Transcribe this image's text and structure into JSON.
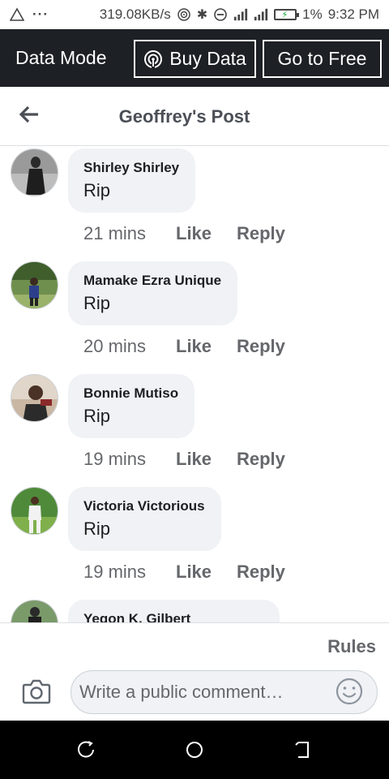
{
  "status_bar": {
    "speed": "319.08KB/s",
    "battery_percent": "1%",
    "time": "9:32 PM"
  },
  "data_bar": {
    "mode_label": "Data Mode",
    "buy_data_label": "Buy Data",
    "go_free_label": "Go to Free"
  },
  "header": {
    "title": "Geoffrey's Post"
  },
  "comments": [
    {
      "author": "Shirley Shirley",
      "text": "Rip",
      "time": "21 mins",
      "like": "Like",
      "reply": "Reply"
    },
    {
      "author": "Mamake Ezra Unique",
      "text": "Rip",
      "time": "20 mins",
      "like": "Like",
      "reply": "Reply"
    },
    {
      "author": "Bonnie Mutiso",
      "text": "Rip",
      "time": "19 mins",
      "like": "Like",
      "reply": "Reply"
    },
    {
      "author": "Victoria Victorious",
      "text": "Rip",
      "time": "19 mins",
      "like": "Like",
      "reply": "Reply"
    },
    {
      "author": "Yegon K. Gilbert",
      "text": "",
      "time": "",
      "like": "",
      "reply": ""
    }
  ],
  "composer": {
    "rules_label": "Rules",
    "placeholder": "Write a public comment…"
  },
  "icons": {
    "back": "back-arrow-icon",
    "camera": "camera-icon",
    "emoji": "smile-icon",
    "buy_data": "hotspot-icon"
  },
  "colors": {
    "data_bar_bg": "#1d2024",
    "bubble_bg": "#f0f2f5",
    "meta_text": "#65676b"
  }
}
